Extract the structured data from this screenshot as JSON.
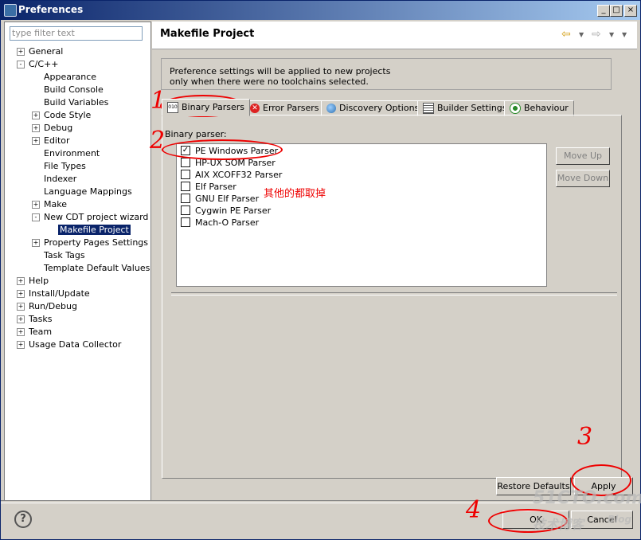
{
  "window": {
    "title": "Preferences"
  },
  "left": {
    "filter_placeholder": "type filter text",
    "tree": [
      {
        "label": "General",
        "indent": 0,
        "exp": "+"
      },
      {
        "label": "C/C++",
        "indent": 0,
        "exp": "-"
      },
      {
        "label": "Appearance",
        "indent": 1,
        "exp": ""
      },
      {
        "label": "Build Console",
        "indent": 1,
        "exp": ""
      },
      {
        "label": "Build Variables",
        "indent": 1,
        "exp": ""
      },
      {
        "label": "Code Style",
        "indent": 1,
        "exp": "+"
      },
      {
        "label": "Debug",
        "indent": 1,
        "exp": "+"
      },
      {
        "label": "Editor",
        "indent": 1,
        "exp": "+"
      },
      {
        "label": "Environment",
        "indent": 1,
        "exp": ""
      },
      {
        "label": "File Types",
        "indent": 1,
        "exp": ""
      },
      {
        "label": "Indexer",
        "indent": 1,
        "exp": ""
      },
      {
        "label": "Language Mappings",
        "indent": 1,
        "exp": ""
      },
      {
        "label": "Make",
        "indent": 1,
        "exp": "+"
      },
      {
        "label": "New CDT project wizard",
        "indent": 1,
        "exp": "-"
      },
      {
        "label": "Makefile Project",
        "indent": 2,
        "exp": "",
        "selected": true
      },
      {
        "label": "Property Pages Settings",
        "indent": 1,
        "exp": "+"
      },
      {
        "label": "Task Tags",
        "indent": 1,
        "exp": ""
      },
      {
        "label": "Template Default Values",
        "indent": 1,
        "exp": ""
      },
      {
        "label": "Help",
        "indent": 0,
        "exp": "+"
      },
      {
        "label": "Install/Update",
        "indent": 0,
        "exp": "+"
      },
      {
        "label": "Run/Debug",
        "indent": 0,
        "exp": "+"
      },
      {
        "label": "Tasks",
        "indent": 0,
        "exp": "+"
      },
      {
        "label": "Team",
        "indent": 0,
        "exp": "+"
      },
      {
        "label": "Usage Data Collector",
        "indent": 0,
        "exp": "+"
      }
    ]
  },
  "right": {
    "title": "Makefile Project",
    "info_line1": "Preference settings will be applied to new projects",
    "info_line2": "only when there were no toolchains selected.",
    "tabs": [
      {
        "label": "Binary Parsers",
        "icon": "binary-icon",
        "active": true
      },
      {
        "label": "Error Parsers",
        "icon": "error-icon",
        "active": false
      },
      {
        "label": "Discovery Options",
        "icon": "globe-icon",
        "active": false
      },
      {
        "label": "Builder Settings",
        "icon": "list-icon",
        "active": false
      },
      {
        "label": "Behaviour",
        "icon": "radio-icon",
        "active": false
      }
    ],
    "binary_parser_label": "Binary parser:",
    "parsers": [
      {
        "label": "PE Windows Parser",
        "checked": true
      },
      {
        "label": "HP-UX SOM Parser",
        "checked": false
      },
      {
        "label": "AIX XCOFF32 Parser",
        "checked": false
      },
      {
        "label": "Elf Parser",
        "checked": false
      },
      {
        "label": "GNU Elf Parser",
        "checked": false
      },
      {
        "label": "Cygwin PE Parser",
        "checked": false
      },
      {
        "label": "Mach-O Parser",
        "checked": false
      }
    ],
    "move_up": "Move Up",
    "move_down": "Move Down",
    "restore_defaults": "Restore Defaults",
    "apply": "Apply"
  },
  "bottom": {
    "ok": "OK",
    "cancel": "Cancel"
  },
  "annotations": {
    "n1": "1",
    "n2": "2",
    "n3": "3",
    "n4": "4",
    "note": "其他的都取掉",
    "watermark1": "51CTO.com",
    "watermark2": "技术博客",
    "watermark3": "Blog"
  }
}
